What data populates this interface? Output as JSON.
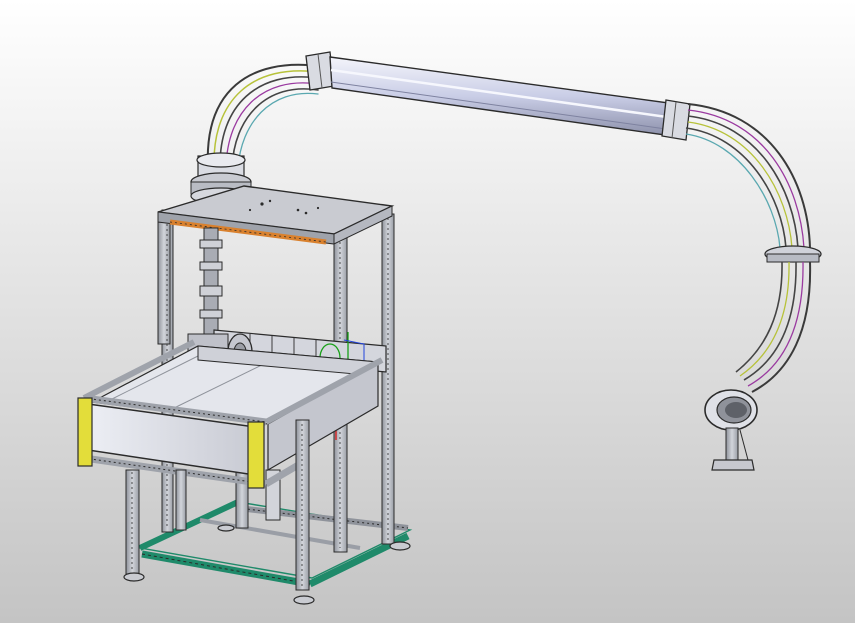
{
  "scene": {
    "background_top": "#ffffff",
    "background_bottom": "#c4c4c4",
    "frame_color": "#b3b7bf",
    "edge_color": "#2b2b2b",
    "tabletop_color": "#c9cbd1",
    "orange_accent": "#d9812e",
    "yellow_accent": "#e3dd3a",
    "green_accent": "#1f8a6a",
    "tube_color": "#c9cde6",
    "tray_color": "#d9dbe2",
    "axis_colors": {
      "x": "#d81f1f",
      "y": "#18a018",
      "z": "#2244dd"
    }
  }
}
